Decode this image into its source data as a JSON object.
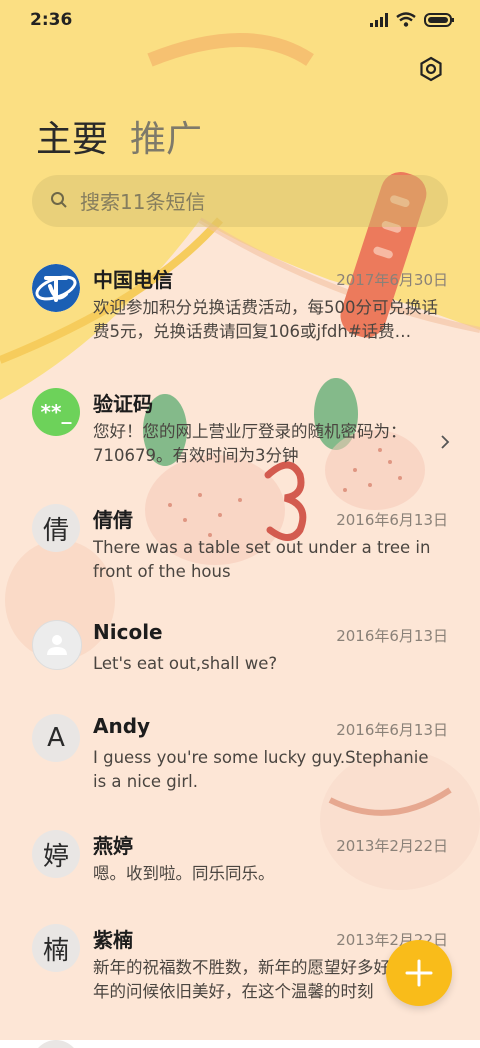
{
  "status_bar": {
    "time": "2:36"
  },
  "tabs": {
    "primary": "主要",
    "promo": "推广"
  },
  "search": {
    "placeholder": "搜索11条短信"
  },
  "conversations": [
    {
      "name": "中国电信",
      "date": "2017年6月30日",
      "preview": "欢迎参加积分兑换话费活动，每500分可兑换话费5元，兑换话费请回复106或jfdh#话费…",
      "avatar": "china-telecom-logo"
    },
    {
      "name": "验证码",
      "date": "",
      "preview": "您好！您的网上营业厅登录的随机密码为：710679。有效时间为3分钟",
      "avatar_text": "**_"
    },
    {
      "name": "倩倩",
      "date": "2016年6月13日",
      "preview": "There was a table set out under a tree in front of the hous",
      "avatar_text": "倩"
    },
    {
      "name": "Nicole",
      "date": "2016年6月13日",
      "preview": "Let's eat out,shall we?",
      "avatar": "person-icon"
    },
    {
      "name": "Andy",
      "date": "2016年6月13日",
      "preview": "I guess you're some lucky guy.Stephanie is a nice girl.",
      "avatar_text": "A"
    },
    {
      "name": "燕婷",
      "date": "2013年2月22日",
      "preview": "嗯。收到啦。同乐同乐。",
      "avatar_text": "婷"
    },
    {
      "name": "紫楠",
      "date": "2013年2月22日",
      "preview": "新年的祝福数不胜数，新年的愿望好多好多，新年的问候依旧美好，在这个温馨的时刻",
      "avatar_text": "楠"
    }
  ],
  "colors": {
    "accent": "#f9bc1a",
    "code_green": "#6dd25a",
    "background_yellow": "#fbdf83",
    "background_peach": "#fde4d2"
  }
}
